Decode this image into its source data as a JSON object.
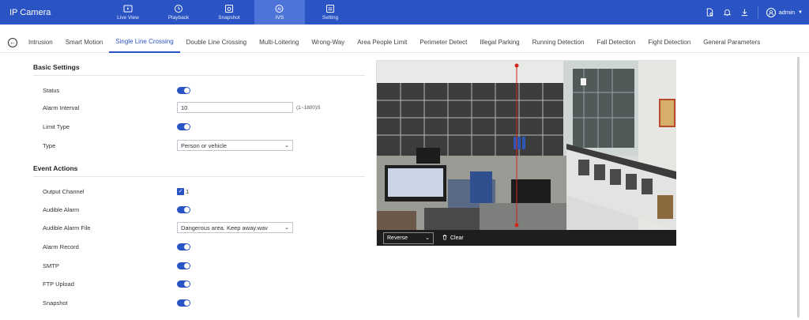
{
  "app": {
    "title": "IP Camera"
  },
  "nav": [
    {
      "label": "Live View",
      "icon": "live-view-icon"
    },
    {
      "label": "Playback",
      "icon": "playback-icon"
    },
    {
      "label": "Snapshot",
      "icon": "snapshot-icon"
    },
    {
      "label": "IVS",
      "icon": "ivs-icon",
      "active": true
    },
    {
      "label": "Setting",
      "icon": "setting-icon"
    }
  ],
  "user": {
    "name": "admin"
  },
  "tabs": [
    "Intrusion",
    "Smart Motion",
    "Single Line Crossing",
    "Double Line Crossing",
    "Multi-Loitering",
    "Wrong-Way",
    "Area People Limit",
    "Perimeter Detect",
    "Illegal Parking",
    "Running Detection",
    "Fall Detection",
    "Fight Detection",
    "General Parameters"
  ],
  "active_tab": "Single Line Crossing",
  "basic": {
    "title": "Basic Settings",
    "status_label": "Status",
    "alarm_interval_label": "Alarm Interval",
    "alarm_interval_value": "10",
    "alarm_interval_hint": "(1~1800)S",
    "limit_type_label": "Limit Type",
    "type_label": "Type",
    "type_value": "Person or vehicle"
  },
  "event": {
    "title": "Event Actions",
    "output_channel_label": "Output Channel",
    "output_channel_value": "1",
    "audible_alarm_label": "Audible Alarm",
    "audible_alarm_file_label": "Audible Alarm File",
    "audible_alarm_file_value": "Dangerous area. Keep away.wav",
    "alarm_record_label": "Alarm Record",
    "smtp_label": "SMTP",
    "ftp_label": "FTP Upload",
    "snapshot_label": "Snapshot"
  },
  "video": {
    "direction_value": "Reverse",
    "clear_label": "Clear"
  },
  "colors": {
    "brand": "#2a54c4",
    "line": "#d0261b"
  }
}
